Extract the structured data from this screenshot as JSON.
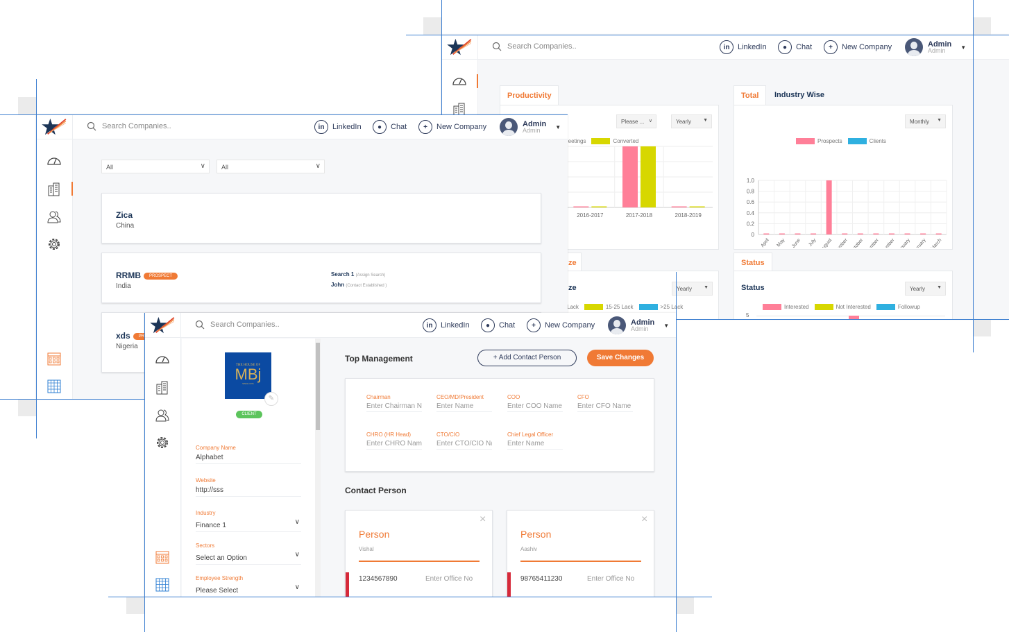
{
  "header": {
    "search_placeholder": "Search Companies..",
    "linkedin": "LinkedIn",
    "chat": "Chat",
    "new_company": "New Company",
    "user_name": "Admin",
    "user_role": "Admin"
  },
  "dashboard": {
    "productivity": {
      "tab": "Productivity",
      "filter1": "Please ...",
      "filter2": "Yearly",
      "legend": [
        "Meetings",
        "Converted"
      ]
    },
    "total": {
      "tabs": [
        "Total",
        "Industry Wise"
      ],
      "filter": "Monthly",
      "legend": [
        "Prospects",
        "Clients"
      ]
    },
    "size": {
      "tab": "ze",
      "title": "ze",
      "filter": "Yearly",
      "legend": [
        "Lack",
        "15-25 Lack",
        ">25 Lack"
      ]
    },
    "status": {
      "tab": "Status",
      "title": "Status",
      "filter": "Yearly",
      "legend": [
        "Interested",
        "Not Interested",
        "Followup"
      ],
      "y_top": "5"
    }
  },
  "colors": {
    "pink": "#ff7f98",
    "yellow": "#d7d700",
    "blue": "#2fb0e0",
    "accent": "#f07a35",
    "navy": "#1c3557",
    "client_green": "#5cc45c"
  },
  "companies": {
    "filters": [
      "All",
      "All"
    ],
    "list": [
      {
        "name": "Zica",
        "country": "China",
        "badge": "",
        "search": "",
        "search_note": "",
        "contact": "",
        "contact_note": ""
      },
      {
        "name": "RRMB",
        "country": "India",
        "badge": "PROSPECT",
        "search": "Search 1",
        "search_note": "(Assign Search)",
        "contact": "John",
        "contact_note": "(Contact Established )"
      },
      {
        "name": "xds",
        "country": "Nigeria",
        "badge": "PRO"
      }
    ]
  },
  "company_edit": {
    "logo_text": {
      "top": "THE HOUSE OF",
      "main": "MBj",
      "sub": "SINCE 1971"
    },
    "status_badge": "CLIENT",
    "fields": [
      {
        "label": "Company Name",
        "value": "Alphabet"
      },
      {
        "label": "Website",
        "value": "http://sss"
      },
      {
        "label": "Industry",
        "value": "Finance 1"
      },
      {
        "label": "Sectors",
        "value": "Select an Option"
      },
      {
        "label": "Employee Strength",
        "value": "Please Select"
      }
    ],
    "top_management_title": "Top Management",
    "add_contact_label": "Add Contact Person",
    "save_label": "Save Changes",
    "management": [
      {
        "label": "Chairman",
        "placeholder": "Enter Chairman Name"
      },
      {
        "label": "CEO/MD/President",
        "placeholder": "Enter Name"
      },
      {
        "label": "COO",
        "placeholder": "Enter COO Name"
      },
      {
        "label": "CFO",
        "placeholder": "Enter CFO Name"
      },
      {
        "label": "CHRO (HR Head)",
        "placeholder": "Enter CHRO Name"
      },
      {
        "label": "CTO/CIO",
        "placeholder": "Enter CTO/CIO Name"
      },
      {
        "label": "Chief Legal Officer",
        "placeholder": "Enter Name"
      }
    ],
    "contact_title": "Contact Person",
    "contacts": [
      {
        "title": "Person",
        "name": "Vishal",
        "phone": "1234567890",
        "office_placeholder": "Enter  Office No"
      },
      {
        "title": "Person",
        "name": "Aashiv",
        "phone": "98765411230",
        "office_placeholder": "Enter  Office No"
      }
    ]
  },
  "chart_data": [
    {
      "type": "bar",
      "title": "",
      "categories": [
        "2016-2017",
        "2017-2018",
        "2018-2019"
      ],
      "series": [
        {
          "name": "Meetings",
          "values": [
            0,
            1,
            0
          ]
        },
        {
          "name": "Converted",
          "values": [
            0,
            1,
            0
          ]
        }
      ],
      "ylim": [
        0,
        1
      ],
      "grid": true,
      "legend": "top"
    },
    {
      "type": "bar",
      "title": "",
      "categories": [
        "April",
        "May",
        "June",
        "July",
        "August",
        "September",
        "October",
        "November",
        "December",
        "January",
        "February",
        "March"
      ],
      "series": [
        {
          "name": "Prospects",
          "values": [
            0,
            0,
            0,
            0,
            1,
            0,
            0,
            0,
            0,
            0,
            0,
            0
          ]
        },
        {
          "name": "Clients",
          "values": [
            0,
            0,
            0,
            0,
            0,
            0,
            0,
            0,
            0,
            0,
            0,
            0
          ]
        }
      ],
      "yticks": [
        "0",
        "0.2",
        "0.4",
        "0.6",
        "0.8",
        "1.0"
      ],
      "ylim": [
        0,
        1
      ],
      "grid": true,
      "legend": "top"
    }
  ]
}
